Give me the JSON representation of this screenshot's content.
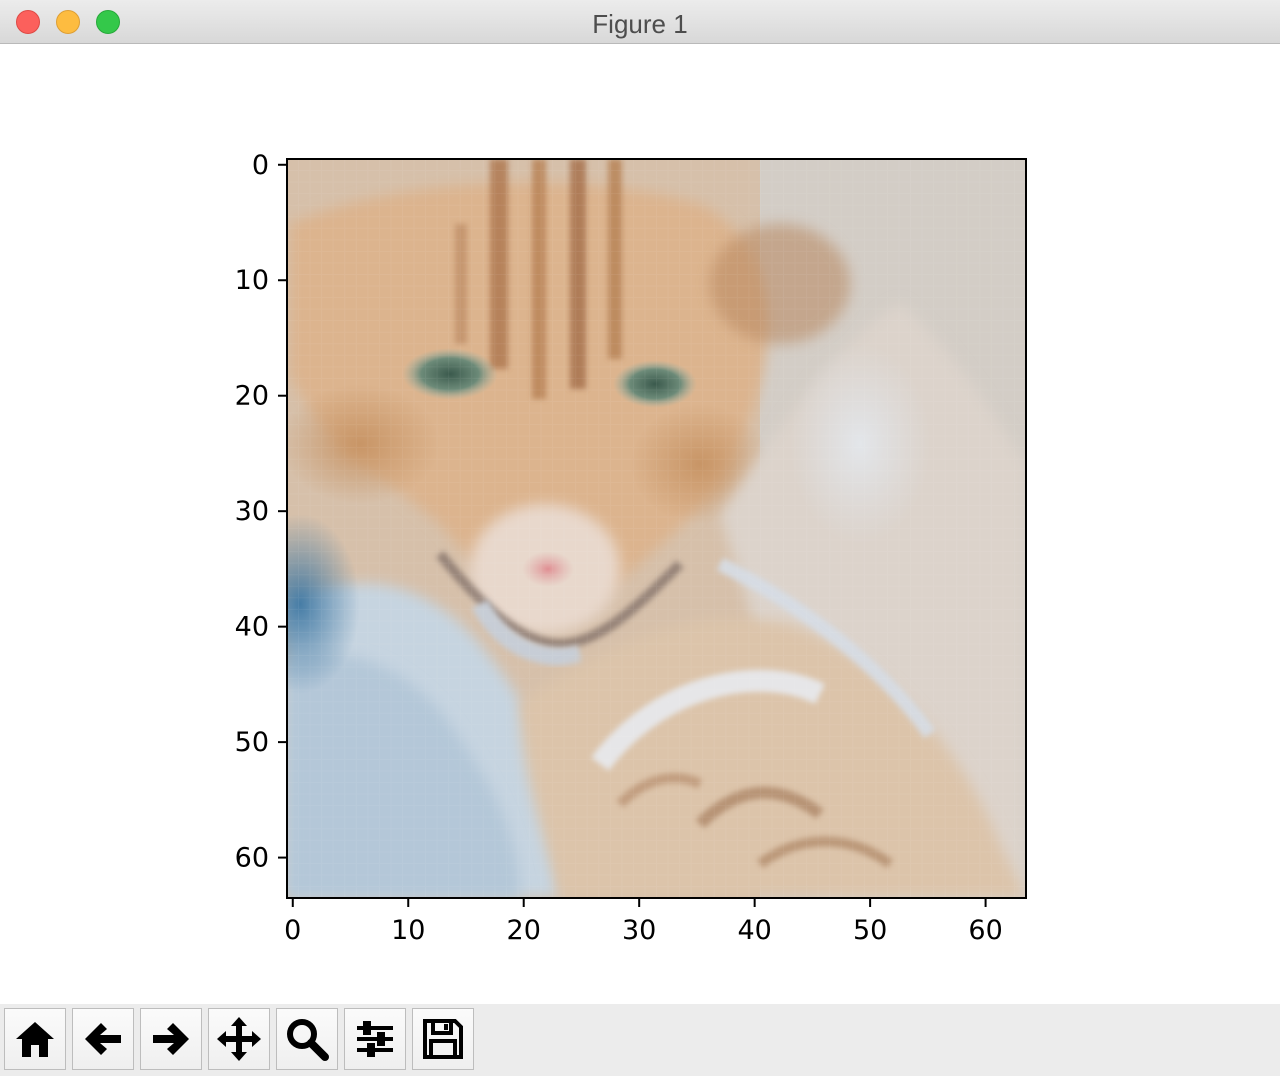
{
  "window": {
    "title": "Figure 1"
  },
  "toolbar": {
    "buttons": [
      {
        "name": "home",
        "icon": "home-icon"
      },
      {
        "name": "back",
        "icon": "arrow-left-icon"
      },
      {
        "name": "forward",
        "icon": "arrow-right-icon"
      },
      {
        "name": "pan",
        "icon": "move-icon"
      },
      {
        "name": "zoom",
        "icon": "magnifier-icon"
      },
      {
        "name": "configure-subplots",
        "icon": "sliders-icon"
      },
      {
        "name": "save",
        "icon": "floppy-disk-icon"
      }
    ]
  },
  "chart_data": {
    "type": "heatmap",
    "content": "64x64 pixel image of an orange tabby cat (imshow)",
    "xlim": [
      -0.5,
      63.5
    ],
    "ylim": [
      63.5,
      -0.5
    ],
    "x_ticks": [
      "0",
      "10",
      "20",
      "30",
      "40",
      "50",
      "60"
    ],
    "y_ticks": [
      "0",
      "10",
      "20",
      "30",
      "40",
      "50",
      "60"
    ],
    "grid": false,
    "colors": {
      "fur": "#d9b48f",
      "stripes": "#b27d52",
      "eyes": "#5e7f6a",
      "nose": "#d99a9a",
      "blanket": "#b9cad8",
      "blue_corner": "#4f82a8"
    }
  }
}
